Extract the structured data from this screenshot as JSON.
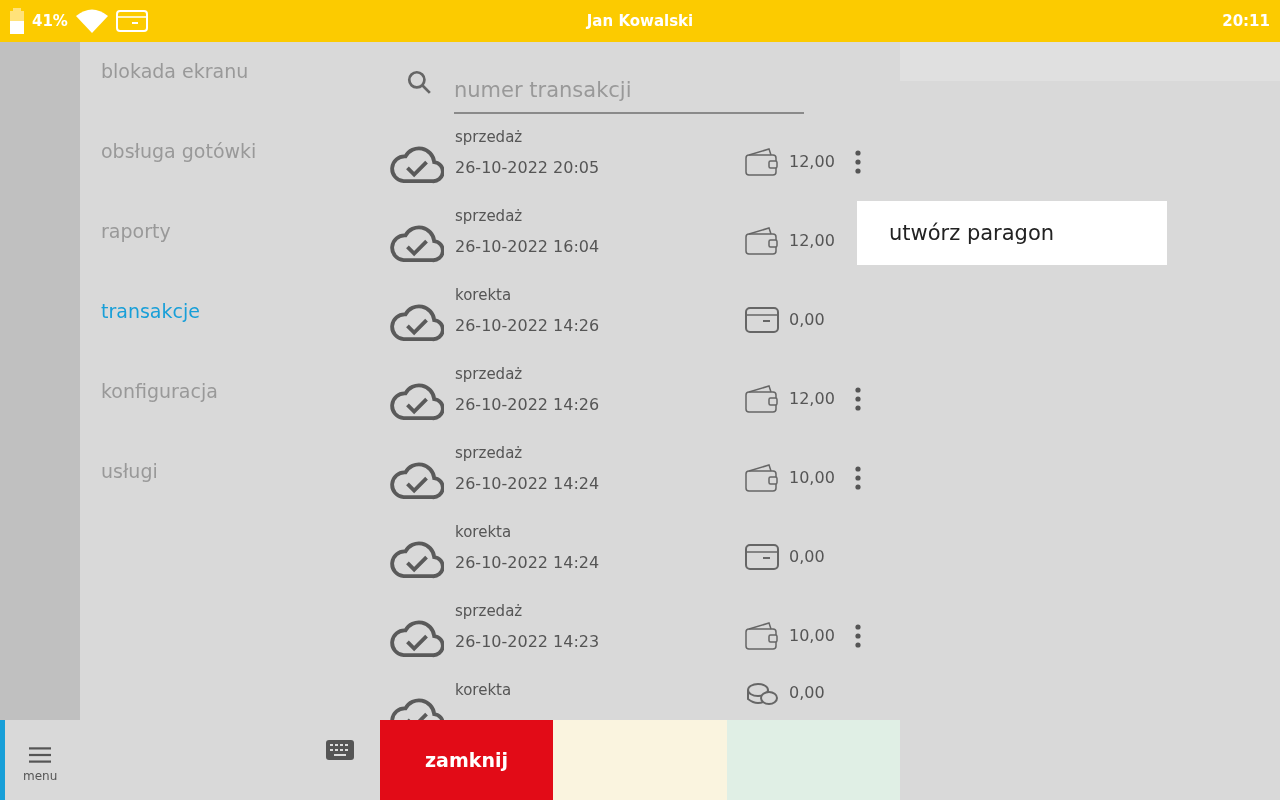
{
  "status_bar": {
    "battery": "41%",
    "user": "Jan Kowalski",
    "time": "20:11"
  },
  "sidebar": {
    "items": [
      {
        "label": "blokada ekranu",
        "selected": false
      },
      {
        "label": "obsługa gotówki",
        "selected": false
      },
      {
        "label": "raporty",
        "selected": false
      },
      {
        "label": "transakcje",
        "selected": true
      },
      {
        "label": "konfiguracja",
        "selected": false
      },
      {
        "label": "usługi",
        "selected": false
      }
    ]
  },
  "search": {
    "placeholder": "numer transakcji"
  },
  "transactions": [
    {
      "type": "sprzedaż",
      "date": "26-10-2022 20:05",
      "kind": "wallet",
      "amount": "12,00",
      "has_menu": true
    },
    {
      "type": "sprzedaż",
      "date": "26-10-2022 16:04",
      "kind": "wallet",
      "amount": "12,00",
      "has_menu": false
    },
    {
      "type": "korekta",
      "date": "26-10-2022 14:26",
      "kind": "card",
      "amount": "0,00",
      "has_menu": false
    },
    {
      "type": "sprzedaż",
      "date": "26-10-2022 14:26",
      "kind": "wallet",
      "amount": "12,00",
      "has_menu": true
    },
    {
      "type": "sprzedaż",
      "date": "26-10-2022 14:24",
      "kind": "wallet",
      "amount": "10,00",
      "has_menu": true
    },
    {
      "type": "korekta",
      "date": "26-10-2022 14:24",
      "kind": "card",
      "amount": "0,00",
      "has_menu": false
    },
    {
      "type": "sprzedaż",
      "date": "26-10-2022 14:23",
      "kind": "wallet",
      "amount": "10,00",
      "has_menu": true
    },
    {
      "type": "korekta",
      "kind": "coins",
      "amount": "0,00",
      "has_menu": false
    }
  ],
  "context_menu": {
    "items": [
      "utwórz paragon"
    ]
  },
  "bottom_bar": {
    "menu_label": "menu",
    "close_button": "zamknij"
  }
}
